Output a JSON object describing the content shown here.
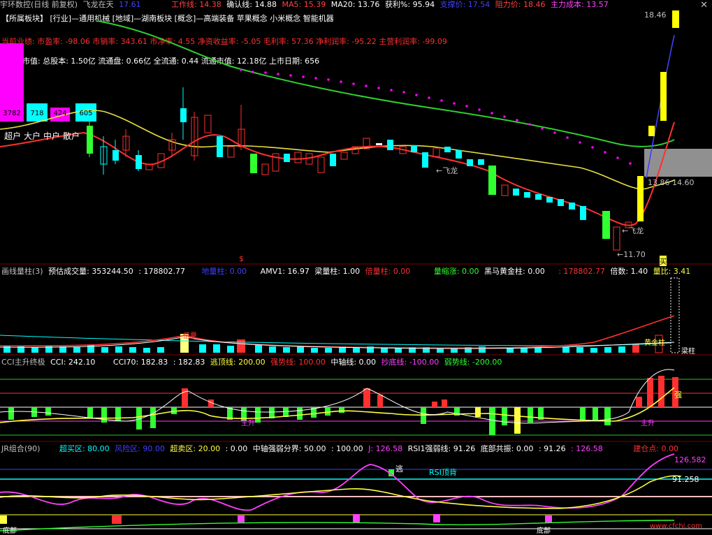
{
  "title_bar": {
    "stock_name": "宇环数控(日线 前复权)",
    "indicator_name": "飞龙在天",
    "indicator_val": "17.61",
    "work_line": "工作线: 14.38",
    "confirm_line": "确认线: 14.88",
    "ma5": "MA5: 15.39",
    "ma20": "MA20: 13.76",
    "profit": "获利%: 95.94",
    "support": "支撑价: 17.54",
    "resistance": "阻力价: 18.46",
    "main_cost": "主力成本: 13.57",
    "close_glyph": "✕"
  },
  "info_lines": {
    "sectors": "【所属板块】 [行业]—通用机械 [地域]—湖南板块 [概念]—高端装备 苹果概念 小米概念 智能机器",
    "financials": "当前业绩: 市盈率: -98.06 市销率: 343.61 市净率: 4.55 净资收益率: -5.05 毛利率: 57.36 净利润率: -95.22 主营利润率: -99.09",
    "equity": "市值: 总股本: 1.50亿 流通盘: 0.66亿 全流通: 0.44 流通市值: 12.18亿 上市日期: 656"
  },
  "holders": {
    "values": [
      "3782",
      "718",
      "424",
      "605"
    ],
    "labels": [
      "超户",
      "大户",
      "中户",
      "散户"
    ],
    "colors": [
      "#ff00ff",
      "#00ffff",
      "#ff00ff",
      "#00ffff"
    ]
  },
  "main_annotations": {
    "high_label": "18.46",
    "mid_label": "13.86",
    "mid_label_right": "14.60",
    "low_label": "←11.70",
    "feilong1": "←飞龙",
    "feilong2": "←飞龙",
    "mark_dollar": "$",
    "mark_buy": "买"
  },
  "volume_pane": {
    "title": "画线量柱(3)",
    "forecast": "预估成交量: 353244.50",
    "vol": ": 178802.77",
    "dilang": "地量柱: 0.00",
    "amv1": "AMV1: 16.97",
    "beam": "梁量柱: 1.00",
    "double": "倍量柱: 0.00",
    "shrink": "量缩涨: 0.00",
    "horse": "黑马黄金柱: 0.00",
    "vol2": ": 178802.77",
    "ratio": "倍数: 1.40",
    "liangbi": "量比: 3.41",
    "label_bei": "倍量",
    "label_gold": "黄金柱",
    "label_beam": "梁柱"
  },
  "cci_pane": {
    "title": "CCI主升终极",
    "cci": "CCI: 242.10",
    "cci70": "CCI70: 182.83",
    "cci70b": ": 182.83",
    "escape": "逃顶线: 200.00",
    "strong": "强势线: 100.00",
    "axis": "中轴线: 0.00",
    "bottom": "抄底线: -100.00",
    "weak": "弱势线: -200.00",
    "mark_strong": "强",
    "mark_rise": "主升",
    "mark_rise2": "主升"
  },
  "jr_pane": {
    "title": "JR组合(90)",
    "oversold": "超买区: 80.00",
    "risk": "风险区: 90.00",
    "overbuy": "超卖区: 20.00",
    "zero": ": 0.00",
    "axis_div": "中轴强弱分界: 50.00",
    "hundred": ": 100.00",
    "j": "J: 126.58",
    "rsi": "RSI1强弱线: 91.26",
    "resonance": "底部共振: 0.00",
    "v1": ": 91.26",
    "v2": ": 126.58",
    "build": "建仓点: 0.00",
    "right_top": "126.582",
    "right_mid": "91.258",
    "mark_escape": "逃",
    "mark_rsi": "RSI顶背",
    "mark_bottom": "底部",
    "mark_bottom2": "底部",
    "watermark": "www.cfchi.com"
  },
  "colors": {
    "up": "#ff3030",
    "down": "#00ffff",
    "ma_yellow": "#ffff50",
    "ma_green": "#30d030",
    "magenta": "#ff00ff",
    "label_blue": "#4040ff"
  }
}
